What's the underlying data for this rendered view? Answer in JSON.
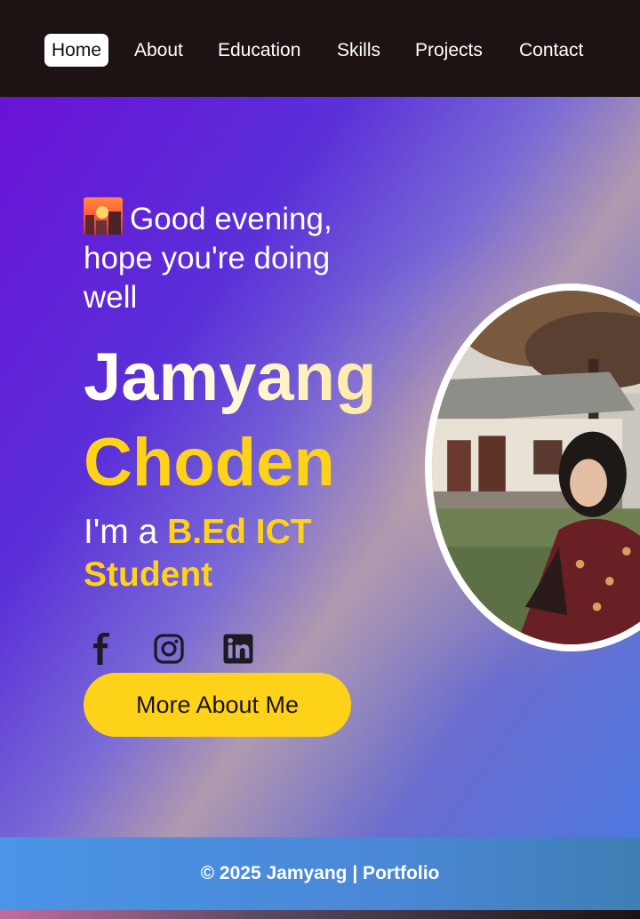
{
  "nav": {
    "items": [
      {
        "label": "Home",
        "active": true
      },
      {
        "label": "About"
      },
      {
        "label": "Education"
      },
      {
        "label": "Skills"
      },
      {
        "label": "Projects"
      },
      {
        "label": "Contact"
      }
    ]
  },
  "hero": {
    "greeting_icon": "sunset-cityscape-emoji",
    "greeting": "Good evening, hope you're doing well",
    "name_first": "Jamyang",
    "name_last": "Choden",
    "role_prefix": "I'm a ",
    "role_highlight": "B.Ed ICT Student",
    "social": [
      {
        "icon": "facebook-icon"
      },
      {
        "icon": "instagram-icon"
      },
      {
        "icon": "linkedin-icon"
      }
    ],
    "cta_label": "More About Me"
  },
  "footer": {
    "text": "© 2025 Jamyang | Portfolio"
  },
  "colors": {
    "accent": "#ffd21a",
    "nav_bg": "#1c1312",
    "footer_bg": "#4b94e6"
  }
}
